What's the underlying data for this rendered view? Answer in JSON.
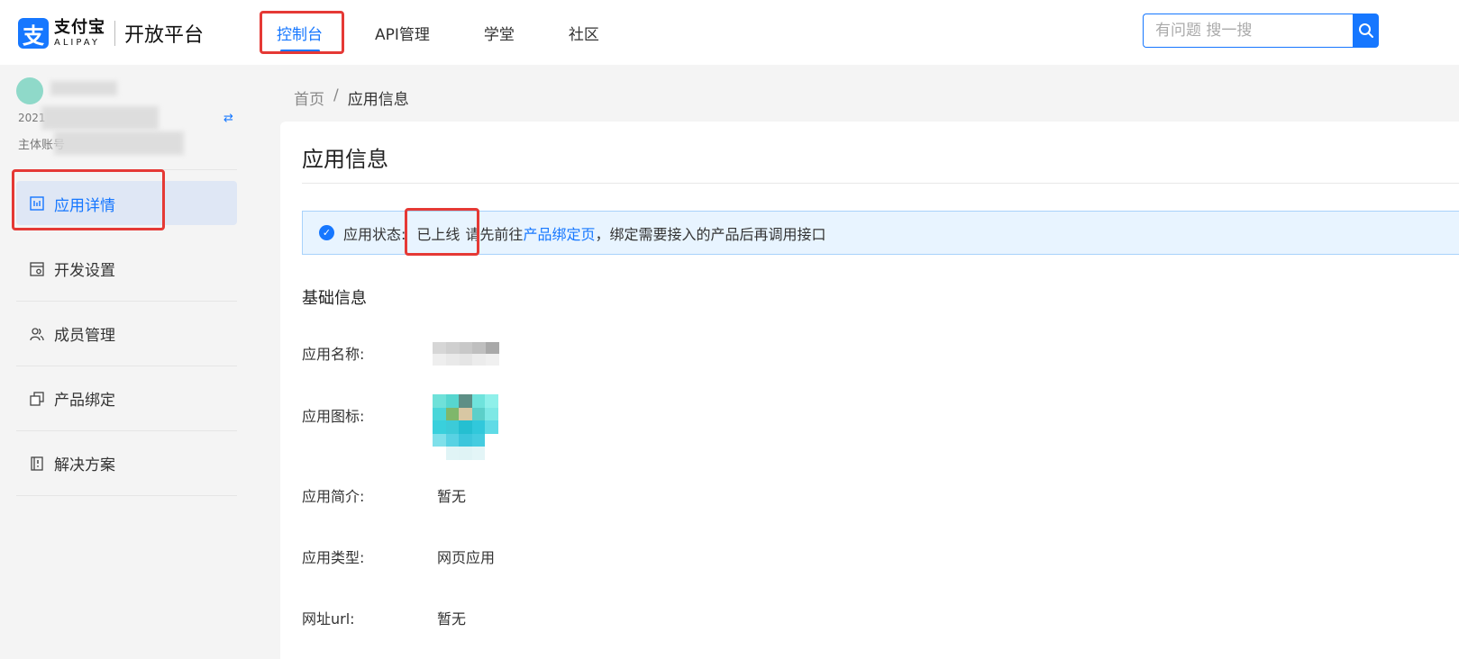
{
  "header": {
    "logo_cn": "支付宝",
    "logo_en": "ALIPAY",
    "platform": "开放平台",
    "nav": [
      {
        "label": "控制台",
        "active": true
      },
      {
        "label": "API管理",
        "active": false
      },
      {
        "label": "学堂",
        "active": false
      },
      {
        "label": "社区",
        "active": false
      }
    ],
    "search_placeholder": "有问题 搜一搜"
  },
  "sidebar": {
    "account_id_prefix": "2021",
    "account_type": "主体账号",
    "items": [
      {
        "label": "应用详情",
        "icon": "chart-icon",
        "active": true
      },
      {
        "label": "开发设置",
        "icon": "settings-doc-icon",
        "active": false
      },
      {
        "label": "成员管理",
        "icon": "members-icon",
        "active": false
      },
      {
        "label": "产品绑定",
        "icon": "bind-icon",
        "active": false
      },
      {
        "label": "解决方案",
        "icon": "solution-icon",
        "active": false
      }
    ]
  },
  "breadcrumb": {
    "home": "首页",
    "separator": "/",
    "current": "应用信息"
  },
  "content": {
    "title": "应用信息",
    "alert": {
      "prefix": "应用状态:",
      "status": "已上线",
      "text_before_link": "请先前往",
      "link": "产品绑定页",
      "text_after_link": "，绑定需要接入的产品后再调用接口"
    },
    "section_title": "基础信息",
    "fields": [
      {
        "label": "应用名称:",
        "value": ""
      },
      {
        "label": "应用图标:",
        "value": ""
      },
      {
        "label": "应用简介:",
        "value": "暂无"
      },
      {
        "label": "应用类型:",
        "value": "网页应用"
      },
      {
        "label": "网址url:",
        "value": "暂无"
      }
    ]
  },
  "colors": {
    "brand": "#1677ff",
    "highlight_box": "#e53935",
    "alert_bg": "#e8f4ff"
  }
}
